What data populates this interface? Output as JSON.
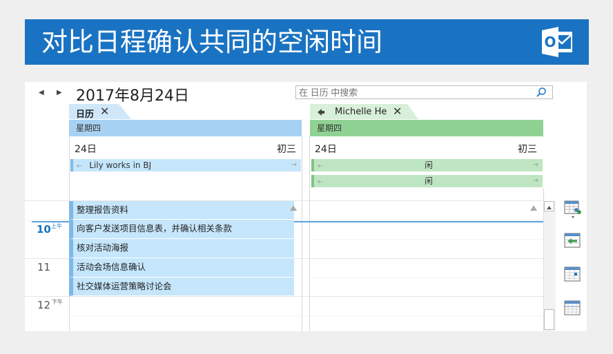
{
  "banner": {
    "title": "对比日程确认共同的空闲时间",
    "logo_letter": "O"
  },
  "nav": {
    "prev_icon": "◀",
    "next_icon": "▶"
  },
  "header": {
    "date": "2017年8月24日"
  },
  "search": {
    "placeholder": "在 日历 中搜索",
    "icon": "search-icon"
  },
  "left_calendar": {
    "tab_label": "日历",
    "close": "✕",
    "weekday": "星期四",
    "day": "24日",
    "lunar": "初三",
    "allday_events": [
      {
        "label": "Lily works in BJ"
      }
    ],
    "events": [
      {
        "label": "整理报告资料"
      },
      {
        "label": "向客户发送项目信息表，并确认相关条款"
      },
      {
        "label": "核对活动海报"
      },
      {
        "label": "活动会场信息确认"
      },
      {
        "label": "社交媒体运营策略讨论会"
      }
    ]
  },
  "right_calendar": {
    "tab_label": "Michelle He",
    "close": "✕",
    "weekday": "星期四",
    "day": "24日",
    "lunar": "初三",
    "allday_events": [
      {
        "label": "闲"
      },
      {
        "label": "闲"
      }
    ]
  },
  "times": [
    {
      "hour": "10",
      "ampm": "上午"
    },
    {
      "hour": "11",
      "ampm": ""
    },
    {
      "hour": "12",
      "ampm": "下午"
    }
  ],
  "colors": {
    "banner": "#1a73c2",
    "left_theme": "#a7d1f3",
    "right_theme": "#8fd294",
    "event_bg": "#c5e6fb",
    "free_bg": "#bfe6c2"
  }
}
